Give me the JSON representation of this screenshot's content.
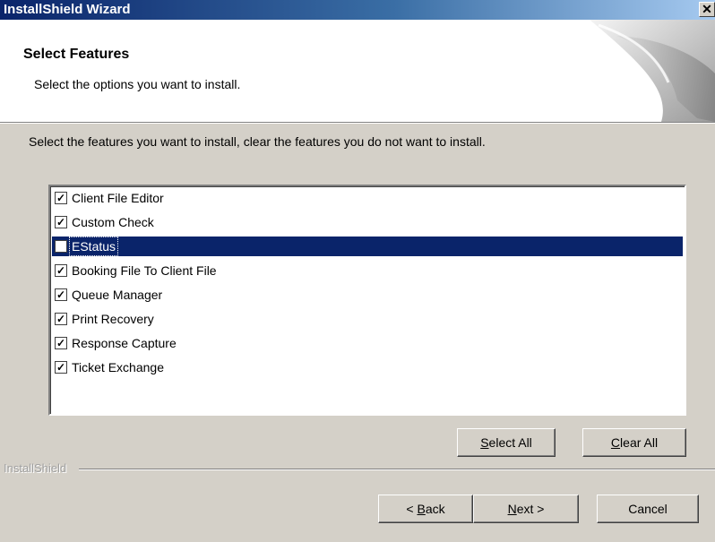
{
  "window": {
    "title": "InstallShield Wizard",
    "close_glyph": "✕"
  },
  "header": {
    "heading": "Select Features",
    "subheading": "Select the options you want to install."
  },
  "instruction": "Select the features you want to install, clear the features you do not want to install.",
  "features": [
    {
      "label": "Client File Editor",
      "checked": true,
      "selected": false
    },
    {
      "label": "Custom Check",
      "checked": true,
      "selected": false
    },
    {
      "label": "EStatus",
      "checked": false,
      "selected": true
    },
    {
      "label": "Booking File To Client File",
      "checked": true,
      "selected": false
    },
    {
      "label": "Queue Manager",
      "checked": true,
      "selected": false
    },
    {
      "label": "Print Recovery",
      "checked": true,
      "selected": false
    },
    {
      "label": "Response Capture",
      "checked": true,
      "selected": false
    },
    {
      "label": "Ticket Exchange",
      "checked": true,
      "selected": false
    }
  ],
  "buttons": {
    "select_all": {
      "mnemonic": "S",
      "rest": "elect All"
    },
    "clear_all": {
      "mnemonic": "C",
      "rest": "lear All"
    },
    "back": {
      "before": "< ",
      "mnemonic": "B",
      "rest": "ack"
    },
    "next": {
      "mnemonic": "N",
      "rest": "ext >"
    },
    "cancel": {
      "label": "Cancel"
    }
  },
  "brand": "InstallShield",
  "colors": {
    "selection": "#0a246a",
    "face": "#d4d0c8"
  }
}
